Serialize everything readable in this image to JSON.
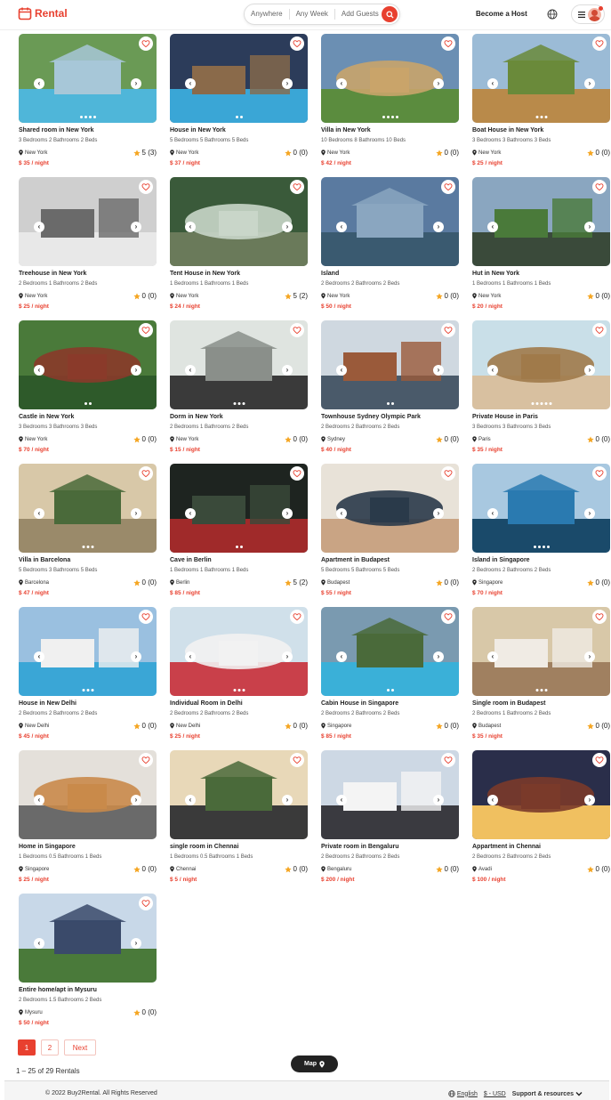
{
  "header": {
    "logo_text": "Rental",
    "search": {
      "where": "Anywhere",
      "when": "Any Week",
      "who": "Add Guests"
    },
    "host_label": "Become a Host"
  },
  "listings": [
    {
      "title": "Shared room in New York",
      "details": "3 Bedrooms  2 Bathrooms  2 Beds",
      "location": "New York",
      "rating": "5 (3)",
      "price": "$ 35 / night",
      "dots": 4,
      "scene": "pool"
    },
    {
      "title": "House in New York",
      "details": "5 Bedrooms  5 Bathrooms  5 Beds",
      "location": "New York",
      "rating": "0 (0)",
      "price": "$ 37 / night",
      "dots": 2,
      "scene": "nightpool"
    },
    {
      "title": "Villa in New York",
      "details": "10 Bedrooms  8 Bathrooms  10 Beds",
      "location": "New York",
      "rating": "0 (0)",
      "price": "$ 42 / night",
      "dots": 4,
      "scene": "villa"
    },
    {
      "title": "Boat House in New York",
      "details": "3 Bedrooms  3 Bathrooms  3 Beds",
      "location": "New York",
      "rating": "0 (0)",
      "price": "$ 25 / night",
      "dots": 3,
      "scene": "boat"
    },
    {
      "title": "Treehouse in New York",
      "details": "2 Bedrooms  1 Bathrooms  2 Beds",
      "location": "New York",
      "rating": "0 (0)",
      "price": "$ 25 / night",
      "dots": 0,
      "scene": "snow"
    },
    {
      "title": "Tent House in New York",
      "details": "1 Bedrooms  1 Bathrooms  1 Beds",
      "location": "New York",
      "rating": "5 (2)",
      "price": "$ 24 / night",
      "dots": 0,
      "scene": "forest"
    },
    {
      "title": "Island",
      "details": "2 Bedrooms  2 Bathrooms  2 Beds",
      "location": "New York",
      "rating": "0 (0)",
      "price": "$ 50 / night",
      "dots": 0,
      "scene": "lake"
    },
    {
      "title": "Hut in New York",
      "details": "1 Bedrooms  1 Bathrooms  1 Beds",
      "location": "New York",
      "rating": "0 (0)",
      "price": "$ 20 / night",
      "dots": 0,
      "scene": "hill"
    },
    {
      "title": "Castle in New York",
      "details": "3 Bedrooms  3 Bathrooms  3 Beds",
      "location": "New York",
      "rating": "0 (0)",
      "price": "$ 70 / night",
      "dots": 2,
      "scene": "castle"
    },
    {
      "title": "Dorm in New York",
      "details": "2 Bedrooms  1 Bathrooms  2 Beds",
      "location": "New York",
      "rating": "0 (0)",
      "price": "$ 15 / night",
      "dots": 3,
      "scene": "desk"
    },
    {
      "title": "Townhouse Sydney Olympic Park",
      "details": "2 Bedrooms  2 Bathrooms  2 Beds",
      "location": "Sydney",
      "rating": "0 (0)",
      "price": "$ 40 / night",
      "dots": 2,
      "scene": "brick"
    },
    {
      "title": "Private House in Paris",
      "details": "3 Bedrooms  3 Bathrooms  3 Beds",
      "location": "Paris",
      "rating": "0 (0)",
      "price": "$ 35 / night",
      "dots": 5,
      "scene": "terrace"
    },
    {
      "title": "Villa in Barcelona",
      "details": "5 Bedrooms  3 Bathrooms  5 Beds",
      "location": "Barcelona",
      "rating": "0 (0)",
      "price": "$ 47 / night",
      "dots": 3,
      "scene": "palms"
    },
    {
      "title": "Cave in Berlin",
      "details": "1 Bedrooms  1 Bathrooms  1 Beds",
      "location": "Berlin",
      "rating": "5 (2)",
      "price": "$ 85 / night",
      "dots": 2,
      "scene": "cave"
    },
    {
      "title": "Apartment in Budapest",
      "details": "5 Bedrooms  5 Bathrooms  5 Beds",
      "location": "Budapest",
      "rating": "0 (0)",
      "price": "$ 55 / night",
      "dots": 0,
      "scene": "loft"
    },
    {
      "title": "Island in Singapore",
      "details": "2 Bedrooms  2 Bathrooms  2 Beds",
      "location": "Singapore",
      "rating": "0 (0)",
      "price": "$ 70 / night",
      "dots": 4,
      "scene": "sea"
    },
    {
      "title": "House in New Delhi",
      "details": "2 Bedrooms  2 Bathrooms  2 Beds",
      "location": "New Delhi",
      "rating": "0 (0)",
      "price": "$ 45 / night",
      "dots": 3,
      "scene": "modern"
    },
    {
      "title": "Individual Room in Delhi",
      "details": "2 Bedrooms  2 Bathrooms  2 Beds",
      "location": "New Delhi",
      "rating": "0 (0)",
      "price": "$ 25 / night",
      "dots": 3,
      "scene": "cottage"
    },
    {
      "title": "Cabin House in Singapore",
      "details": "2 Bedrooms  2 Bathrooms  2 Beds",
      "location": "Singapore",
      "rating": "0 (0)",
      "price": "$ 85 / night",
      "dots": 2,
      "scene": "infinity"
    },
    {
      "title": "Single room in Budapest",
      "details": "2 Bedrooms  1 Bathrooms  2 Beds",
      "location": "Budapest",
      "rating": "0 (0)",
      "price": "$ 35 / night",
      "dots": 3,
      "scene": "bedroom"
    },
    {
      "title": "Home in Singapore",
      "details": "1 Bedrooms  0.5 Bathrooms  1 Beds",
      "location": "Singapore",
      "rating": "0 (0)",
      "price": "$ 25 / night",
      "dots": 0,
      "scene": "livingroom"
    },
    {
      "title": "single room in Chennai",
      "details": "1 Bedrooms  0.5 Bathrooms  1 Beds",
      "location": "Chennai",
      "rating": "0 (0)",
      "price": "$ 5 / night",
      "dots": 0,
      "scene": "garden"
    },
    {
      "title": "Private room in Bengaluru",
      "details": "2 Bedrooms  2 Bathrooms  2 Beds",
      "location": "Bengaluru",
      "rating": "0 (0)",
      "price": "$ 200 / night",
      "dots": 0,
      "scene": "whitehouse"
    },
    {
      "title": "Appartment in Chennai",
      "details": "2 Bedrooms  2 Bathrooms  2 Beds",
      "location": "Avadi",
      "rating": "0 (0)",
      "price": "$ 100 / night",
      "dots": 0,
      "scene": "dusk"
    },
    {
      "title": "Entire home/apt in Mysuru",
      "details": "2 Bedrooms  1.5 Bathrooms  2 Beds",
      "location": "Mysuru",
      "rating": "0 (0)",
      "price": "$ 50 / night",
      "dots": 0,
      "scene": "bluehouse"
    }
  ],
  "pagination": {
    "pages": [
      "1",
      "2"
    ],
    "next": "Next",
    "active": "1"
  },
  "result_count": "1 – 25 of 29 Rentals",
  "map_button": "Map",
  "footer": {
    "copyright": "© 2022 Buy2Rental. All Rights Reserved",
    "language": "English",
    "currency": "$ - USD",
    "support": "Support & resources"
  },
  "colors": {
    "accent": "#e8402f",
    "star": "#f5a623"
  },
  "scene_colors": {
    "pool": [
      "#6a9a55",
      "#a7c7d8",
      "#4fb6d9"
    ],
    "nightpool": [
      "#2c3c5a",
      "#8a6a4a",
      "#3aa6d6"
    ],
    "villa": [
      "#6b8fb3",
      "#c9a46a",
      "#5b8c3e"
    ],
    "boat": [
      "#9bbbd6",
      "#6a8a3a",
      "#b98a4a"
    ],
    "snow": [
      "#cfcfcf",
      "#6a6a6a",
      "#e8e8e8"
    ],
    "forest": [
      "#3a5a3a",
      "#c9d6c9",
      "#6a7a5a"
    ],
    "lake": [
      "#5a7aa0",
      "#8aa6c0",
      "#3a5a70"
    ],
    "hill": [
      "#8aa6c0",
      "#4a7a3a",
      "#3a4a3a"
    ],
    "castle": [
      "#4a7a3a",
      "#8a3a2a",
      "#2e5a2a"
    ],
    "desk": [
      "#dfe4e0",
      "#8a8f8a",
      "#3a3a3a"
    ],
    "brick": [
      "#cfd8e0",
      "#9a5a3a",
      "#4a5a6a"
    ],
    "terrace": [
      "#c9dfe8",
      "#a07a4a",
      "#d8c0a0"
    ],
    "palms": [
      "#d8c8a8",
      "#4a6a3a",
      "#9a8a6a"
    ],
    "cave": [
      "#1e2420",
      "#3a4a3a",
      "#a02a2a"
    ],
    "loft": [
      "#e8e2d8",
      "#2a3a4a",
      "#c9a484"
    ],
    "sea": [
      "#a8c8e0",
      "#2a7ab0",
      "#1a4a6a"
    ],
    "modern": [
      "#9ac0e0",
      "#f0f0f0",
      "#3aa6d6"
    ],
    "cottage": [
      "#d0e0ea",
      "#f2f2f2",
      "#c9404a"
    ],
    "infinity": [
      "#7a9ab0",
      "#4a6a3a",
      "#3ab0d8"
    ],
    "bedroom": [
      "#d8c8a8",
      "#f0ebe4",
      "#a08060"
    ],
    "livingroom": [
      "#e4e0da",
      "#c98a4a",
      "#6a6a6a"
    ],
    "garden": [
      "#e8d8b8",
      "#4a6a3a",
      "#3a3a3a"
    ],
    "whitehouse": [
      "#cdd8e4",
      "#f4f4f4",
      "#3a3a40"
    ],
    "dusk": [
      "#2a2e4a",
      "#7a3a2a",
      "#f0c060"
    ],
    "bluehouse": [
      "#c8d8e8",
      "#3a4a6a",
      "#4a7a3a"
    ]
  }
}
